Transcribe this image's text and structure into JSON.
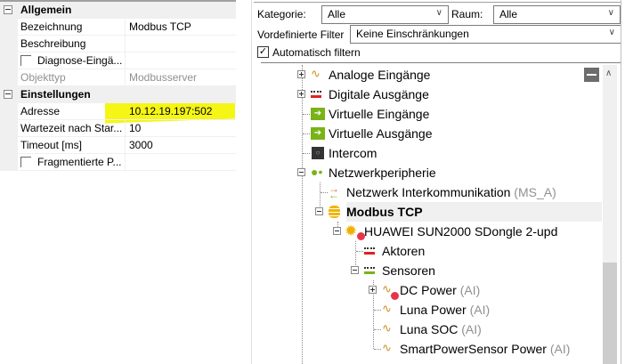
{
  "properties": {
    "categories": [
      {
        "label": "Allgemein",
        "rows": [
          {
            "label": "Bezeichnung",
            "value": "Modbus TCP"
          },
          {
            "label": "Beschreibung",
            "value": ""
          },
          {
            "label": "Diagnose-Eingä...",
            "value": "",
            "checkbox": true
          },
          {
            "label": "Objekttyp",
            "value": "Modbusserver",
            "readonly": true
          }
        ]
      },
      {
        "label": "Einstellungen",
        "rows": [
          {
            "label": "Adresse",
            "value": "10.12.19.197:502"
          },
          {
            "label": "Wartezeit nach Star...",
            "value": "10"
          },
          {
            "label": "Timeout [ms]",
            "value": "3000"
          },
          {
            "label": "Fragmentierte P...",
            "value": "",
            "checkbox": true
          }
        ]
      }
    ],
    "highlight_color": "#f5f516"
  },
  "filters": {
    "kategorie_label": "Kategorie:",
    "kategorie_value": "Alle",
    "raum_label": "Raum:",
    "raum_value": "Alle",
    "vordefiniert_label": "Vordefinierte Filter",
    "vordefiniert_value": "Keine Einschränkungen",
    "auto_filter_label": "Automatisch filtern",
    "auto_filter_checked": true
  },
  "tree": [
    {
      "label": "Analoge Eingänge",
      "icon": "analog-input-icon"
    },
    {
      "label": "Digitale Ausgänge",
      "icon": "digital-output-icon"
    },
    {
      "label": "Virtuelle Eingänge",
      "icon": "virtual-input-icon"
    },
    {
      "label": "Virtuelle Ausgänge",
      "icon": "virtual-output-icon"
    },
    {
      "label": "Intercom",
      "icon": "intercom-icon"
    },
    {
      "label": "Netzwerkperipherie",
      "icon": "network-icon"
    },
    {
      "label": "Netzwerk Interkommunikation",
      "suffix": "(MS_A)",
      "icon": "intercommunication-icon"
    },
    {
      "label": "Modbus TCP",
      "icon": "database-icon"
    },
    {
      "label": "HUAWEI SUN2000 SDongle 2-upd",
      "icon": "device-icon"
    },
    {
      "label": "Aktoren",
      "icon": "actuators-icon"
    },
    {
      "label": "Sensoren",
      "icon": "sensors-icon"
    },
    {
      "label": "DC Power",
      "suffix": "(AI)",
      "icon": "analog-input-icon"
    },
    {
      "label": "Luna Power",
      "suffix": "(AI)",
      "icon": "analog-input-icon"
    },
    {
      "label": "Luna SOC",
      "suffix": "(AI)",
      "icon": "analog-input-icon"
    },
    {
      "label": "SmartPowerSensor Power",
      "suffix": "(AI)",
      "icon": "analog-input-icon"
    }
  ]
}
